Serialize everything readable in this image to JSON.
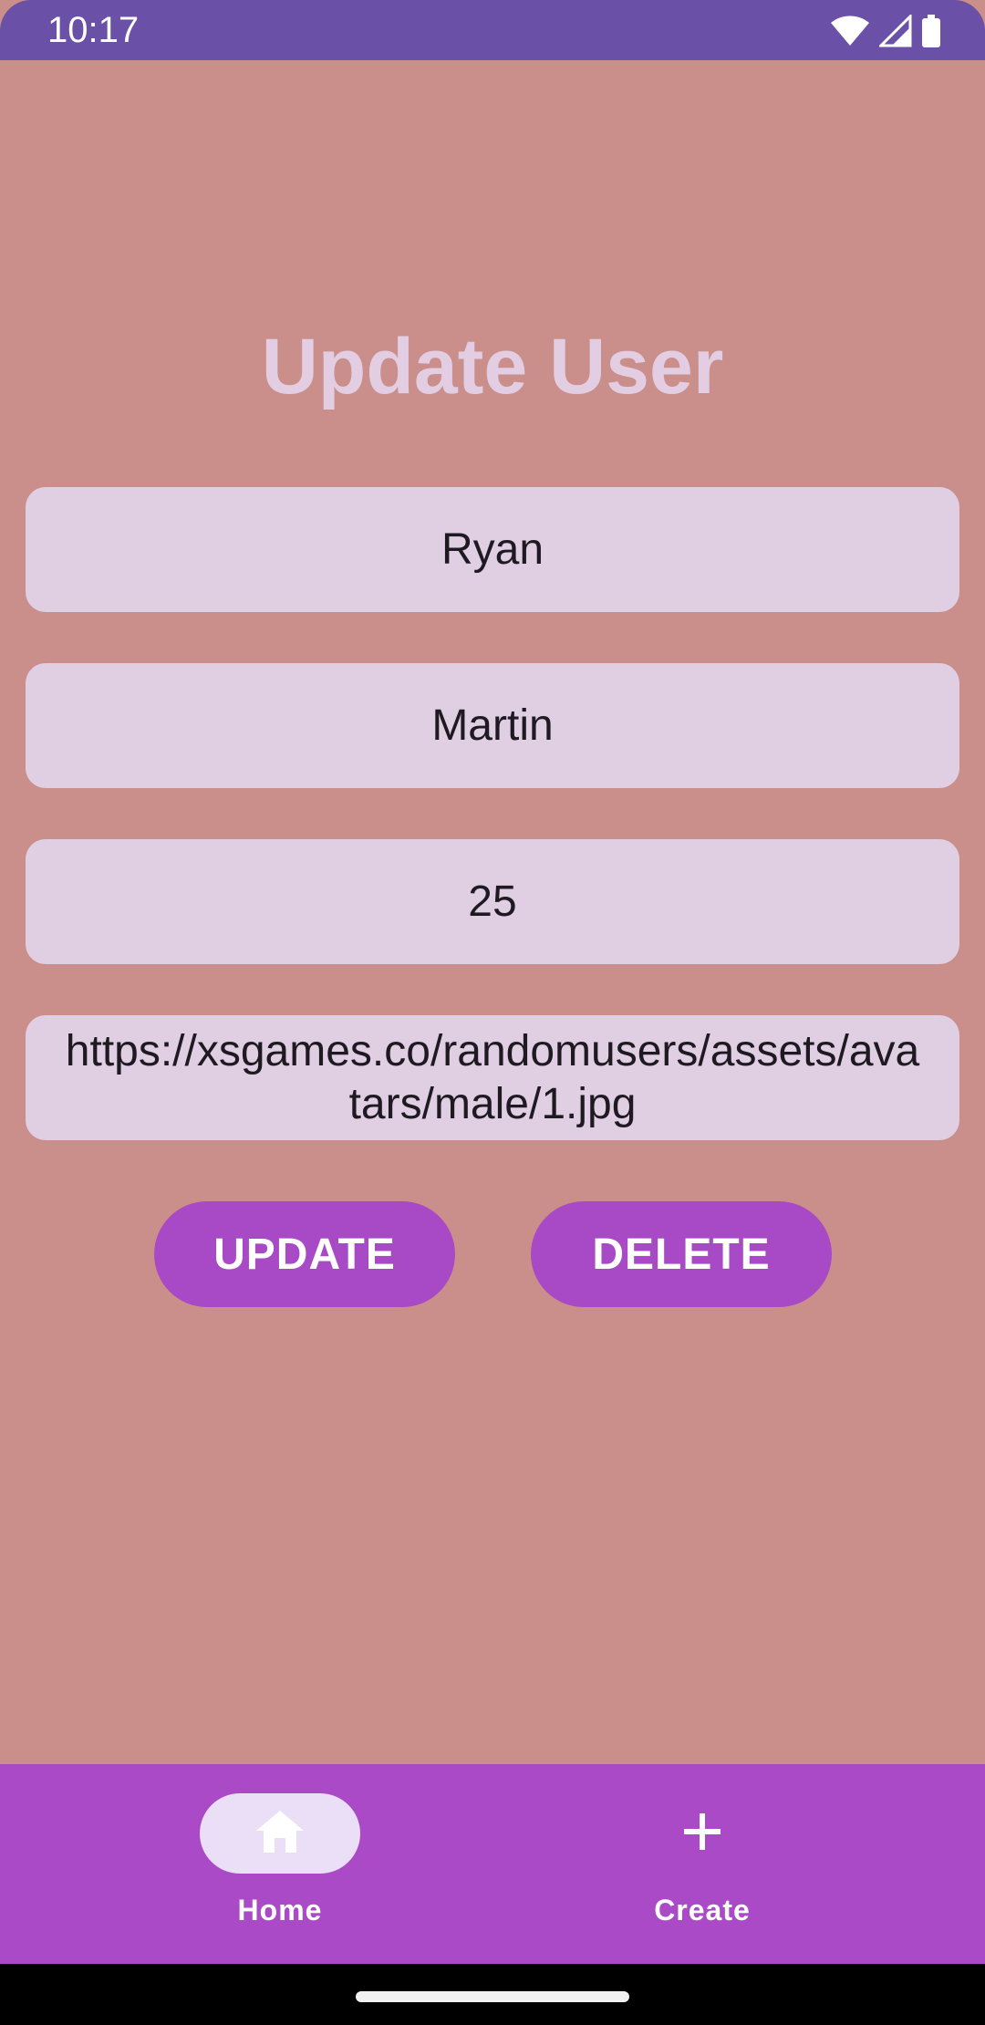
{
  "status_bar": {
    "time": "10:17",
    "icons": [
      "wifi-icon",
      "signal-icon",
      "battery-icon"
    ]
  },
  "page": {
    "title": "Update User"
  },
  "form": {
    "first_name": "Ryan",
    "last_name": "Martin",
    "age": "25",
    "avatar_url": "https://xsgames.co/randomusers/assets/avatars/male/1.jpg"
  },
  "actions": {
    "update_label": "UPDATE",
    "delete_label": "DELETE"
  },
  "bottom_nav": {
    "items": [
      {
        "label": "Home",
        "icon": "home-icon",
        "active": true
      },
      {
        "label": "Create",
        "icon": "plus-icon",
        "active": false
      }
    ]
  },
  "colors": {
    "background": "#ca8f8b",
    "status_bar": "#6a50a7",
    "accent": "#aa4ac6",
    "field": "#e0cfe3",
    "title": "#e2cde3"
  }
}
